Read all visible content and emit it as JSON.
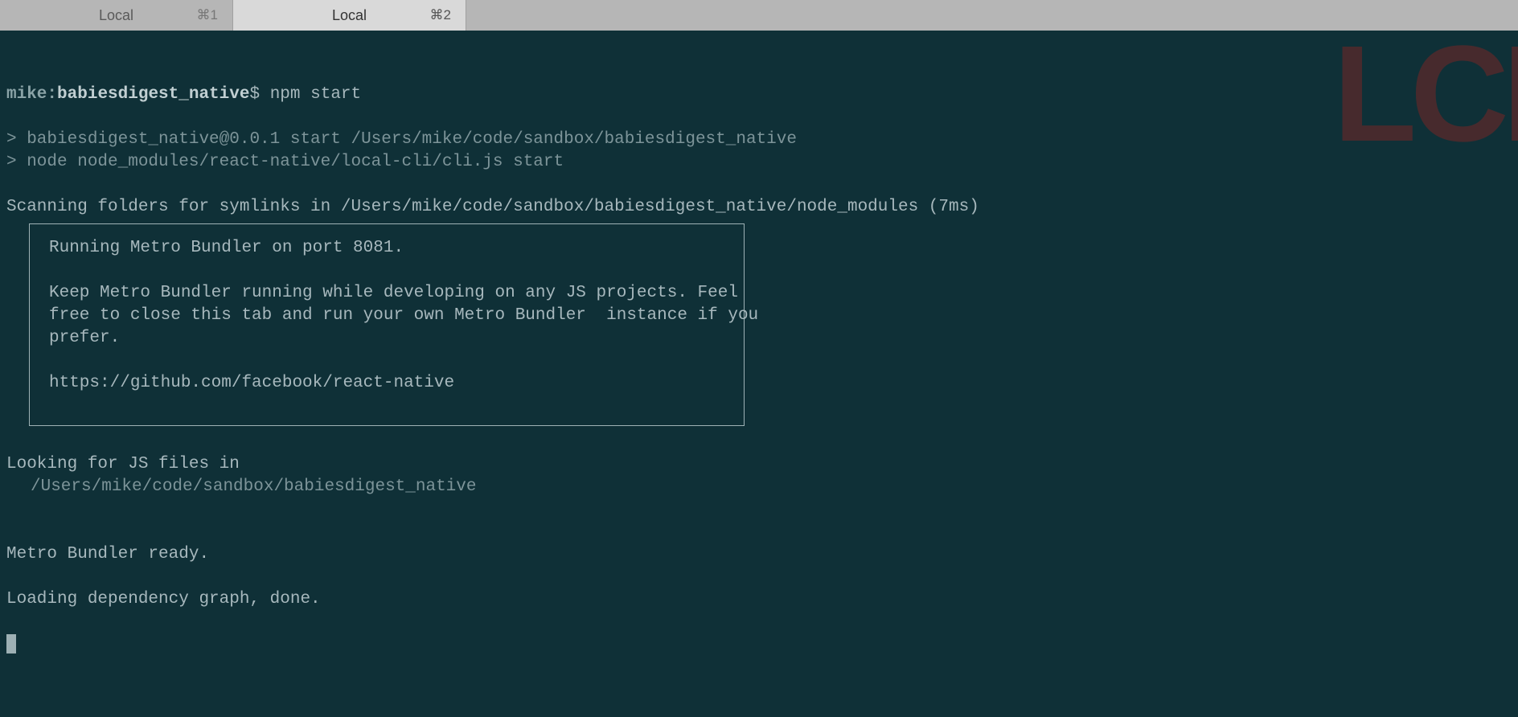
{
  "tabs": [
    {
      "label": "Local",
      "shortcut": "⌘1",
      "active": false
    },
    {
      "label": "Local",
      "shortcut": "⌘2",
      "active": true
    }
  ],
  "prompt": {
    "user": "mike",
    "sep": ":",
    "path": "babiesdigest_native",
    "symbol": "$",
    "command": "npm start"
  },
  "output": {
    "line1": "> babiesdigest_native@0.0.1 start /Users/mike/code/sandbox/babiesdigest_native",
    "line2": "> node node_modules/react-native/local-cli/cli.js start",
    "scan": "Scanning folders for symlinks in /Users/mike/code/sandbox/babiesdigest_native/node_modules (7ms)",
    "box": {
      "l1": "Running Metro Bundler on port 8081.",
      "l2": "Keep Metro Bundler running while developing on any JS projects. Feel",
      "l3": "free to close this tab and run your own Metro Bundler  instance if you",
      "l4": "prefer.",
      "l5": "https://github.com/facebook/react-native"
    },
    "looking": "Looking for JS files in",
    "looking_path": "/Users/mike/code/sandbox/babiesdigest_native",
    "ready": "Metro Bundler ready.",
    "done": "Loading dependency graph, done."
  },
  "watermark": "LCI"
}
